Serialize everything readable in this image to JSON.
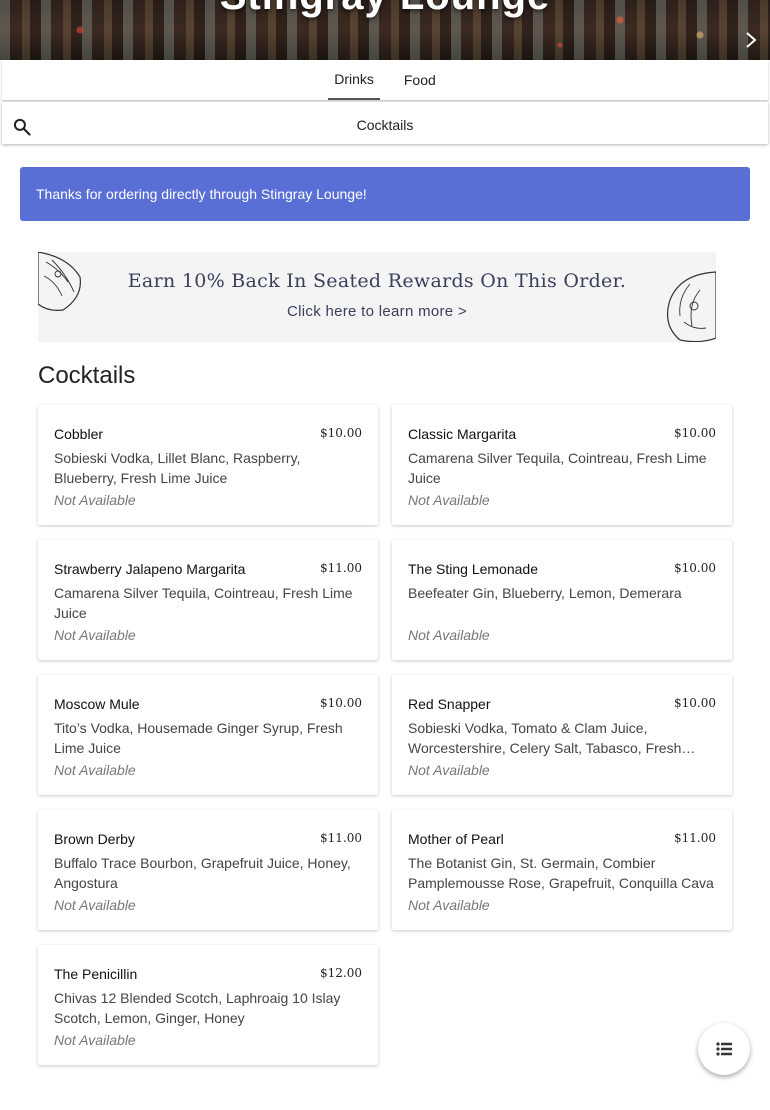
{
  "hero": {
    "title": "Stingray Lounge"
  },
  "tabs": [
    {
      "label": "Drinks",
      "active": true
    },
    {
      "label": "Food",
      "active": false
    }
  ],
  "search": {
    "category": "Cocktails",
    "icon": "search-icon"
  },
  "notice": {
    "text": "Thanks for ordering directly through Stingray Lounge!",
    "color": "#5a6fd6"
  },
  "promo": {
    "title": "Earn 10% Back In Seated Rewards On This Order.",
    "link": "Click here to learn more >"
  },
  "section": {
    "title": "Cocktails"
  },
  "items": [
    {
      "name": "Cobbler",
      "price": "$10.00",
      "description": "Sobieski Vodka, Lillet Blanc, Raspberry, Blueberry, Fresh Lime Juice",
      "status": "Not Available"
    },
    {
      "name": "Classic Margarita",
      "price": "$10.00",
      "description": "Camarena Silver Tequila, Cointreau, Fresh Lime Juice",
      "status": "Not Available"
    },
    {
      "name": "Strawberry Jalapeno Margarita",
      "price": "$11.00",
      "description": "Camarena Silver Tequila, Cointreau, Fresh Lime Juice",
      "status": "Not Available"
    },
    {
      "name": "The Sting Lemonade",
      "price": "$10.00",
      "description": "Beefeater Gin, Blueberry, Lemon, Demerara",
      "status": "Not Available"
    },
    {
      "name": "Moscow Mule",
      "price": "$10.00",
      "description": "Tito’s Vodka, Housemade Ginger Syrup, Fresh Lime Juice",
      "status": "Not Available"
    },
    {
      "name": "Red Snapper",
      "price": "$10.00",
      "description": "Sobieski Vodka, Tomato & Clam Juice, Worcestershire, Celery Salt, Tabasco, Fresh Lemon Juice",
      "status": "Not Available"
    },
    {
      "name": "Brown Derby",
      "price": "$11.00",
      "description": "Buffalo Trace Bourbon, Grapefruit Juice, Honey, Angostura",
      "status": "Not Available"
    },
    {
      "name": "Mother of Pearl",
      "price": "$11.00",
      "description": "The Botanist Gin, St. Germain, Combier Pamplemousse Rose, Grapefruit, Conquilla Cava",
      "status": "Not Available"
    },
    {
      "name": "The Penicillin",
      "price": "$12.00",
      "description": "Chivas 12 Blended Scotch, Laphroaig 10 Islay Scotch, Lemon, Ginger, Honey",
      "status": "Not Available"
    }
  ],
  "fab": {
    "icon": "menu-list-icon"
  }
}
